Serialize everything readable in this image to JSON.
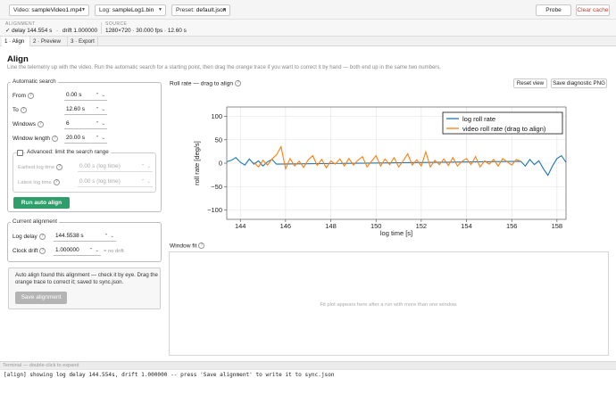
{
  "topbar": {
    "video_label": "Video:",
    "video_value": "sampleVideo1.mp4",
    "log_label": "Log:",
    "log_value": "sampleLog1.bin",
    "preset_label": "Preset:",
    "preset_value": "default.json",
    "probe": "Probe",
    "clear_cache": "Clear cache"
  },
  "status": {
    "alignment_head": "ALIGNMENT",
    "alignment_check": "✓",
    "alignment_delay": "delay 144.554 s",
    "alignment_sep": "·",
    "alignment_drift": "drift 1.000000",
    "source_head": "SOURCE",
    "source_value": "1280×720 · 30.000 fps · 12.60 s"
  },
  "tabs": [
    {
      "label": "1 · Align"
    },
    {
      "label": "2 · Preview"
    },
    {
      "label": "3 · Export"
    }
  ],
  "align": {
    "title": "Align",
    "desc": "Line the telemetry up with the video. Run the automatic search for a starting point, then drag the orange trace if you want to correct it by hand — both end up in the same two numbers.",
    "auto": {
      "title": "Automatic search",
      "from_label": "From",
      "from_value": "0.00 s",
      "to_label": "To",
      "to_value": "12.60 s",
      "windows_label": "Windows",
      "windows_value": "6",
      "wlen_label": "Window length",
      "wlen_value": "20.00 s",
      "adv_label": "Advanced: limit the search range",
      "earliest_label": "Earliest log time",
      "earliest_value": "0.00 s (log time)",
      "latest_label": "Latest log time",
      "latest_value": "0.00 s (log time)",
      "run": "Run auto align"
    },
    "current": {
      "title": "Current alignment",
      "delay_label": "Log delay",
      "delay_value": "144.5538 s",
      "drift_label": "Clock drift",
      "drift_value": "1.000000",
      "drift_note": "= no drift"
    },
    "info": "Auto align found this alignment — check it by eye. Drag the orange trace to correct it; saved to sync.json.",
    "save": "Save alignment",
    "plot_title": "Roll rate — drag to align",
    "reset_view": "Reset view",
    "save_png": "Save diagnostic PNG",
    "window_fit_title": "Window fit",
    "window_fit_placeholder": "Fit plot appears here after a run with more than one window."
  },
  "terminal": {
    "bar": "Terminal — double-click to expand",
    "line": "[align] showing log delay 144.554s, drift 1.000000 -- press 'Save alignment' to write it to sync.json"
  },
  "colors": {
    "accent_green": "#2e9e6b",
    "log_series": "#1f77b4",
    "video_series": "#ff7f0e",
    "clear_cache_text": "#c0392b"
  },
  "chart_data": {
    "type": "line",
    "xlabel": "log time [s]",
    "ylabel": "roll rate [deg/s]",
    "xlim": [
      143.4,
      158.4
    ],
    "ylim": [
      -120,
      120
    ],
    "xticks": [
      144,
      146,
      148,
      150,
      152,
      154,
      156,
      158
    ],
    "yticks": [
      100,
      50,
      0,
      -50,
      -100
    ],
    "grid": true,
    "legend_position": "top-right",
    "series": [
      {
        "name": "log roll rate",
        "color": "#1f77b4",
        "x": [
          143.4,
          143.6,
          143.8,
          144.0,
          144.2,
          144.4,
          144.6,
          144.8,
          145.0,
          145.2,
          145.4,
          145.6,
          156.4,
          156.6,
          156.8,
          157.0,
          157.2,
          157.4,
          157.6,
          157.8,
          158.0,
          158.2,
          158.4
        ],
        "y": [
          3,
          6,
          12,
          2,
          -4,
          9,
          -2,
          5,
          -6,
          3,
          8,
          -2,
          4,
          -6,
          8,
          -3,
          5,
          -12,
          -26,
          -6,
          10,
          16,
          2
        ]
      },
      {
        "name": "video roll rate (drag to align)",
        "color": "#ff7f0e",
        "x": [
          144.6,
          144.8,
          145.0,
          145.2,
          145.4,
          145.6,
          145.8,
          146.0,
          146.2,
          146.4,
          146.6,
          146.8,
          147.0,
          147.2,
          147.4,
          147.6,
          147.8,
          148.0,
          148.2,
          148.4,
          148.6,
          148.8,
          149.0,
          149.2,
          149.4,
          149.6,
          149.8,
          150.0,
          150.2,
          150.4,
          150.6,
          150.8,
          151.0,
          151.2,
          151.4,
          151.6,
          151.8,
          152.0,
          152.2,
          152.4,
          152.6,
          152.8,
          153.0,
          153.2,
          153.4,
          153.6,
          153.8,
          154.0,
          154.2,
          154.4,
          154.6,
          154.8,
          155.0,
          155.2,
          155.4,
          155.6,
          155.8,
          156.0,
          156.2,
          156.4
        ],
        "y": [
          2,
          -8,
          6,
          -4,
          9,
          18,
          35,
          -12,
          10,
          -6,
          4,
          -9,
          7,
          16,
          -5,
          8,
          -10,
          5,
          -2,
          9,
          -6,
          10,
          -4,
          6,
          14,
          -8,
          4,
          16,
          -6,
          9,
          -3,
          12,
          -8,
          5,
          20,
          -4,
          7,
          -6,
          24,
          -8,
          6,
          -3,
          9,
          -5,
          12,
          -6,
          4,
          10,
          -3,
          14,
          -8,
          5,
          -2,
          8,
          -6,
          10,
          3,
          -4,
          8,
          4
        ]
      }
    ]
  }
}
